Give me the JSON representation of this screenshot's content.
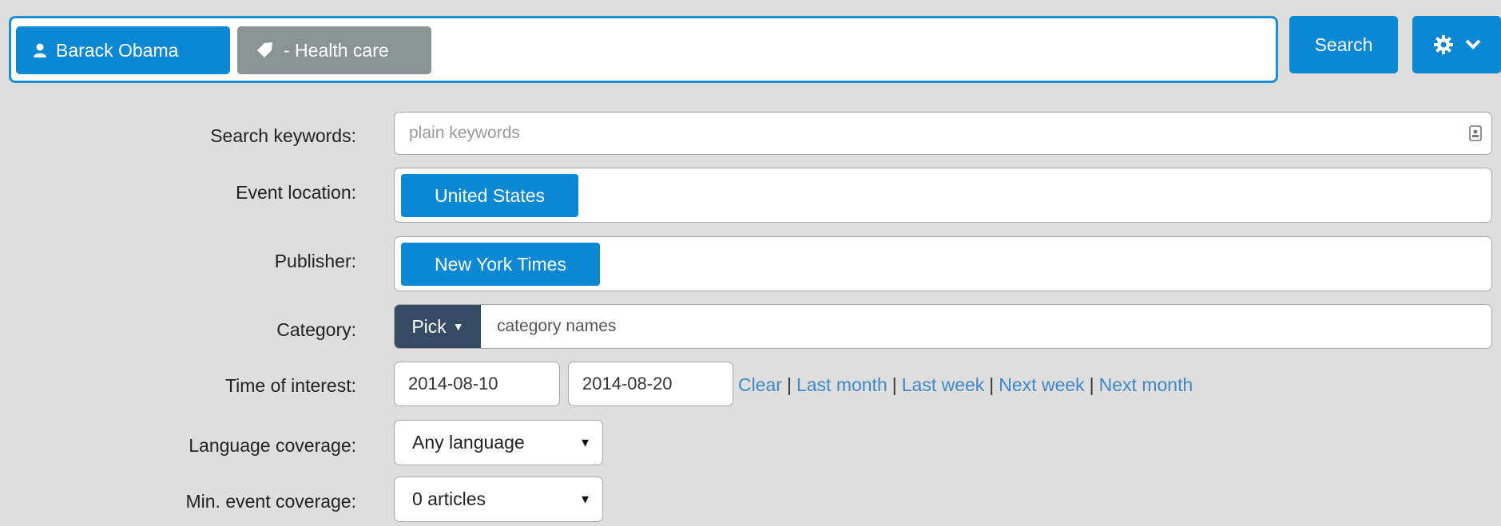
{
  "topbar": {
    "person_chip": "Barack Obama",
    "topic_chip": "- Health care",
    "search_button": "Search",
    "settings_icon": "gear-icon",
    "dropdown_icon": "chevron-down-icon"
  },
  "form": {
    "keywords": {
      "label": "Search keywords:",
      "placeholder": "plain keywords"
    },
    "location": {
      "label": "Event location:",
      "tag": "United States"
    },
    "publisher": {
      "label": "Publisher:",
      "tag": "New York Times"
    },
    "category": {
      "label": "Category:",
      "pick_label": "Pick",
      "placeholder": "category names"
    },
    "time": {
      "label": "Time of interest:",
      "start": "2014-08-10",
      "end": "2014-08-20",
      "links": [
        "Clear",
        "Last month",
        "Last week",
        "Next week",
        "Next month"
      ]
    },
    "language": {
      "label": "Language coverage:",
      "value": "Any language"
    },
    "coverage": {
      "label": "Min. event coverage:",
      "value": "0 articles"
    }
  },
  "colors": {
    "accent": "#0a88d3",
    "tag_grey": "#8a9495",
    "pick_dark": "#354a63",
    "link": "#3f88c5",
    "background": "#dedede"
  }
}
